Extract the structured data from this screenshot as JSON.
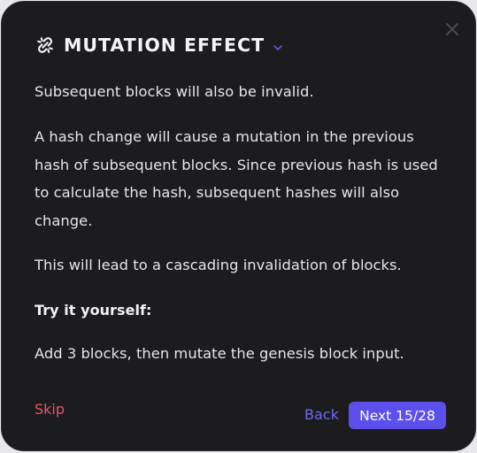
{
  "dialog": {
    "title": "MUTATION EFFECT",
    "title_icon": "broken-link-icon",
    "title_menu_icon": "chevron-down-icon",
    "close_icon": "close-icon",
    "paragraphs": [
      "Subsequent blocks will also be invalid.",
      "A hash change will cause a mutation in the previous hash of subsequent blocks. Since previous hash is used to calculate the hash, subsequent hashes will also change.",
      "This will lead to a cascading invalidation of blocks.",
      "Try it yourself:",
      "Add 3 blocks, then mutate the genesis block input."
    ]
  },
  "footer": {
    "skip_label": "Skip",
    "back_label": "Back",
    "next_label": "Next 15/28"
  },
  "colors": {
    "background": "#1c1c1f",
    "text": "#e6e6ea",
    "skip": "#e2566a",
    "back": "#6e69f0",
    "next_button": "#5b50ec",
    "chevron": "#5f5ae6",
    "close": "#4a4a52"
  }
}
